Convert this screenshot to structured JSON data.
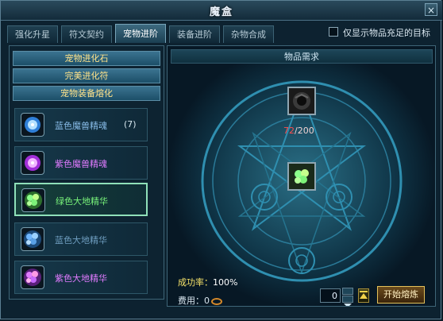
{
  "window": {
    "title": "魔盒",
    "close_label": "×"
  },
  "tabs": [
    {
      "label": "强化升星"
    },
    {
      "label": "符文契约"
    },
    {
      "label": "宠物进阶"
    },
    {
      "label": "装备进阶"
    },
    {
      "label": "杂物合成"
    }
  ],
  "filter": {
    "label": "仅显示物品充足的目标"
  },
  "left": {
    "categories": [
      {
        "label": "宠物进化石"
      },
      {
        "label": "完美进化符"
      },
      {
        "label": "宠物装备熔化"
      }
    ],
    "items": [
      {
        "name": "蓝色魔兽精魂",
        "count": "(7)",
        "color": "#87bbe7"
      },
      {
        "name": "紫色魔兽精魂",
        "count": "",
        "color": "#e07bff"
      },
      {
        "name": "绿色大地精华",
        "count": "",
        "color": "#78f27a"
      },
      {
        "name": "蓝色大地精华",
        "count": "",
        "color": "#6f9ec0"
      },
      {
        "name": "紫色大地精华",
        "count": "",
        "color": "#e07bff"
      }
    ]
  },
  "right": {
    "header": "物品需求",
    "requirement": {
      "have": "72",
      "need": "200"
    },
    "success_label": "成功率：",
    "success_value": "100%",
    "fee_label": "费用：",
    "fee_value": "0",
    "quantity": "0",
    "start_label": "开始熔炼"
  }
}
